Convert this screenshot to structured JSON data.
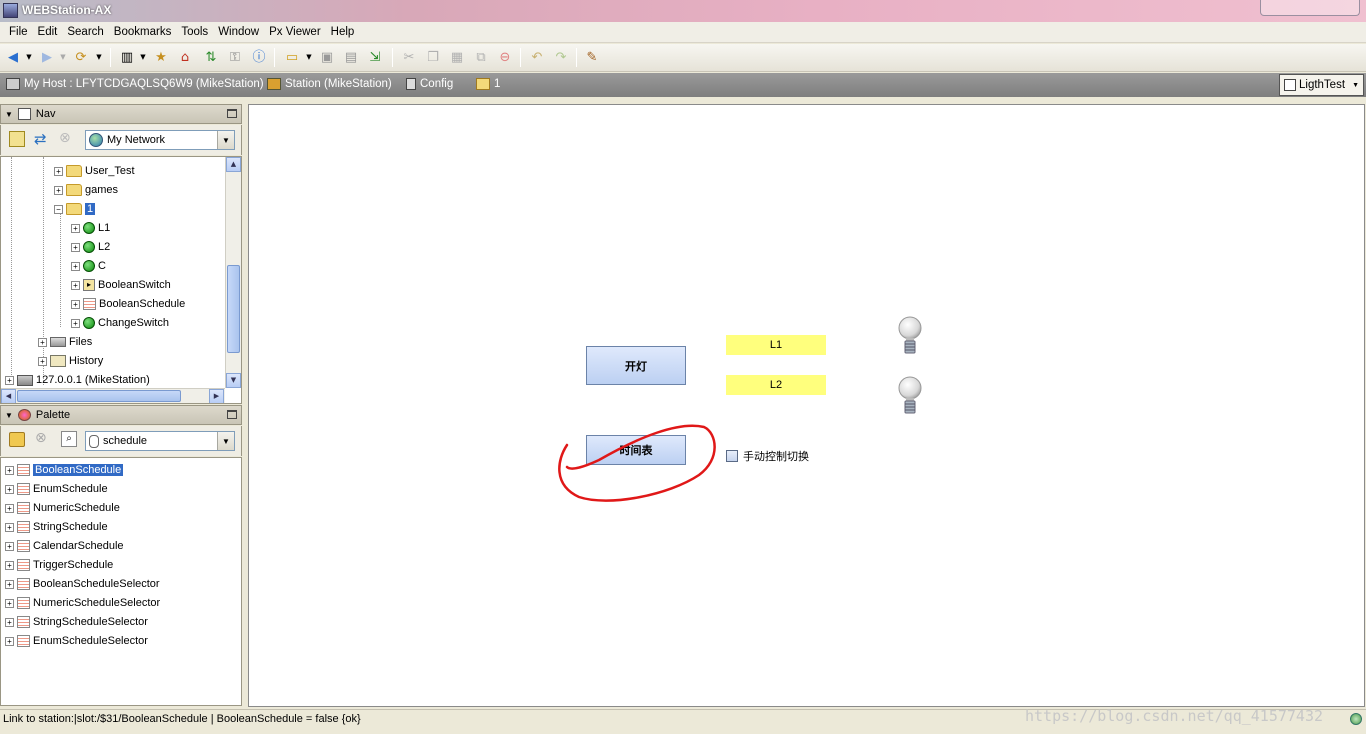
{
  "window": {
    "title": "WEBStation-AX"
  },
  "menu": [
    "File",
    "Edit",
    "Search",
    "Bookmarks",
    "Tools",
    "Window",
    "Px Viewer",
    "Help"
  ],
  "toolbar": {
    "icons": [
      "back-icon",
      "forward-icon",
      "refresh-icon",
      "side-bar-icon",
      "bookmark-icon",
      "home-icon",
      "sync-icon",
      "info-icon",
      "open-icon",
      "save-icon",
      "save-all-icon",
      "export-icon",
      "cut-icon",
      "copy-icon",
      "paste-icon",
      "duplicate-icon",
      "delete-icon",
      "undo-icon",
      "redo-icon",
      "edit-icon"
    ]
  },
  "pathbar": {
    "host": "My Host : LFYTCDGAQLSQ6W9 (MikeStation)",
    "station": "Station (MikeStation)",
    "config": "Config",
    "folder": "1",
    "view": "LigthTest"
  },
  "nav": {
    "title": "Nav",
    "combo": "My Network",
    "items": [
      {
        "label": "User_Test",
        "icon": "folder"
      },
      {
        "label": "games",
        "icon": "folder"
      },
      {
        "label": "1",
        "icon": "folder"
      },
      {
        "label": "L1",
        "icon": "dot"
      },
      {
        "label": "L2",
        "icon": "dot"
      },
      {
        "label": "C",
        "icon": "dot"
      },
      {
        "label": "BooleanSwitch",
        "icon": "switch"
      },
      {
        "label": "BooleanSchedule",
        "icon": "schedule"
      },
      {
        "label": "ChangeSwitch",
        "icon": "dot"
      },
      {
        "label": "Files",
        "icon": "files"
      },
      {
        "label": "History",
        "icon": "history"
      },
      {
        "label": "127.0.0.1 (MikeStation)",
        "icon": "host"
      }
    ]
  },
  "palette": {
    "title": "Palette",
    "combo": "schedule",
    "items": [
      "BooleanSchedule",
      "EnumSchedule",
      "NumericSchedule",
      "StringSchedule",
      "CalendarSchedule",
      "TriggerSchedule",
      "BooleanScheduleSelector",
      "NumericScheduleSelector",
      "StringScheduleSelector",
      "EnumScheduleSelector"
    ]
  },
  "canvas": {
    "btn_light": "开灯",
    "btn_schedule": "时间表",
    "label_l1": "L1",
    "label_l2": "L2",
    "checkbox_label": "手动控制切换",
    "checkbox_checked": false
  },
  "status": {
    "text": "Link to station:|slot:/$31/BooleanSchedule | BooleanSchedule = false {ok}",
    "watermark": "https://blog.csdn.net/qq_41577432"
  },
  "colors": {
    "label_bg": "#ffff7d",
    "annotation": "#e01818",
    "selection": "#316ac5"
  }
}
